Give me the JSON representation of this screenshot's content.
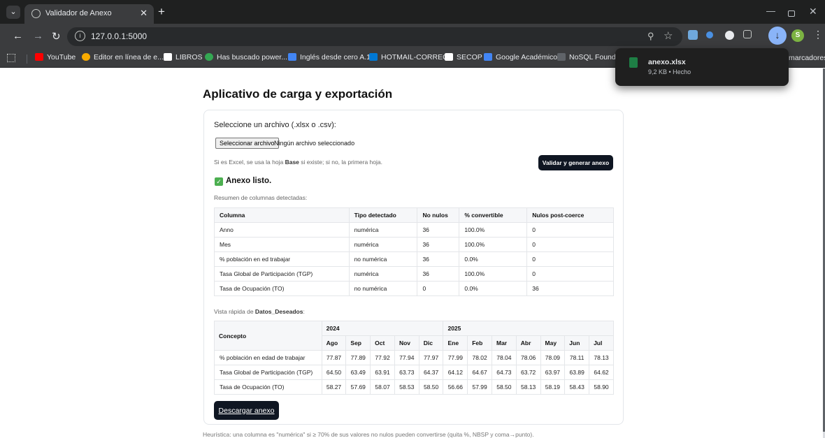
{
  "browser": {
    "tab_title": "Validador de Anexo",
    "url": "127.0.0.1:5000",
    "bookmarks": [
      {
        "label": "YouTube",
        "color": "#ff0000"
      },
      {
        "label": "Editor en línea de e...",
        "color": "#f9ab00"
      },
      {
        "label": "LIBROS",
        "color": "#ffffff"
      },
      {
        "label": "Has buscado power...",
        "color": "#34a853"
      },
      {
        "label": "Inglés desde cero A.1",
        "color": "#4285f4"
      },
      {
        "label": "HOTMAIL-CORREO",
        "color": "#0078d4"
      },
      {
        "label": "SECOP",
        "color": "#ffffff"
      },
      {
        "label": "Google Académico",
        "color": "#4285f4"
      },
      {
        "label": "NoSQL Foundat",
        "color": "#5f6368"
      }
    ],
    "bookmarks_more": "marcadores",
    "profile_initial": "S",
    "download_popup": {
      "file_name": "anexo.xlsx",
      "status": "9,2 KB • Hecho"
    }
  },
  "page": {
    "title": "Aplicativo de carga y exportación",
    "file_label": "Seleccione un archivo (.xlsx o .csv):",
    "choose_button": "Seleccionar archivo",
    "no_file": "Ningún archivo seleccionado",
    "help_prefix": "Si es Excel, se usa la hoja ",
    "help_sheet": "Base",
    "help_suffix": " si existe; si no, la primera hoja.",
    "validate_button": "Validar y generar anexo",
    "ready_text": "Anexo listo.",
    "summary_label": "Resumen de columnas detectadas:",
    "quick_prefix": "Vista rápida de ",
    "quick_sheet": "Datos_Deseados",
    "quick_suffix": ":",
    "download_button": "Descargar anexo",
    "footnote": "Heurística: una columna es \"numérica\" si ≥ 70% de sus valores no nulos pueden convertirse (quita %, NBSP y coma→punto)."
  },
  "summary_table": {
    "headers": [
      "Columna",
      "Tipo detectado",
      "No nulos",
      "% convertible",
      "Nulos post-coerce"
    ],
    "rows": [
      [
        "Anno",
        "numérica",
        "36",
        "100.0%",
        "0"
      ],
      [
        "Mes",
        "numérica",
        "36",
        "100.0%",
        "0"
      ],
      [
        "% población en ed trabajar",
        "no numérica",
        "36",
        "0.0%",
        "0"
      ],
      [
        "Tasa Global de Participación (TGP)",
        "numérica",
        "36",
        "100.0%",
        "0"
      ],
      [
        "Tasa de Ocupación (TO)",
        "no numérica",
        "0",
        "0.0%",
        "36"
      ]
    ]
  },
  "preview_table": {
    "concept_header": "Concepto",
    "years": [
      {
        "label": "2024",
        "span": 5
      },
      {
        "label": "2025",
        "span": 7
      }
    ],
    "months": [
      "Ago",
      "Sep",
      "Oct",
      "Nov",
      "Dic",
      "Ene",
      "Feb",
      "Mar",
      "Abr",
      "May",
      "Jun",
      "Jul"
    ],
    "rows": [
      {
        "concept": "% población en edad de trabajar",
        "values": [
          "77.87",
          "77.89",
          "77.92",
          "77.94",
          "77.97",
          "77.99",
          "78.02",
          "78.04",
          "78.06",
          "78.09",
          "78.11",
          "78.13"
        ]
      },
      {
        "concept": "Tasa Global de Participación (TGP)",
        "values": [
          "64.50",
          "63.49",
          "63.91",
          "63.73",
          "64.37",
          "64.12",
          "64.67",
          "64.73",
          "63.72",
          "63.97",
          "63.89",
          "64.62"
        ]
      },
      {
        "concept": "Tasa de Ocupación (TO)",
        "values": [
          "58.27",
          "57.69",
          "58.07",
          "58.53",
          "58.50",
          "56.66",
          "57.99",
          "58.50",
          "58.13",
          "58.19",
          "58.43",
          "58.90"
        ]
      }
    ]
  }
}
